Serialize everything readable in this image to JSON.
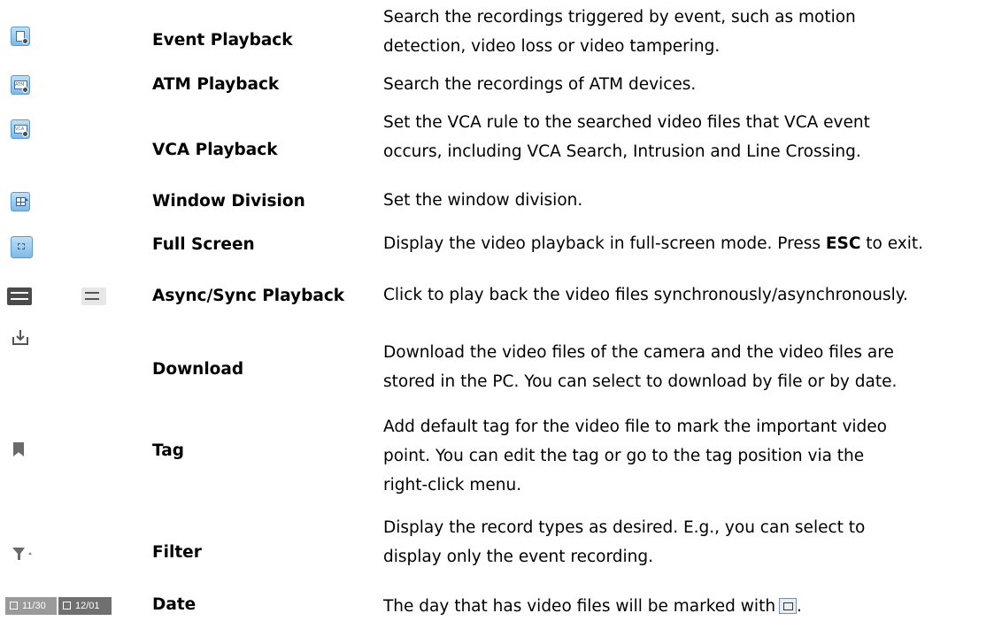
{
  "rows": [
    {
      "name": "Event Playback",
      "desc": [
        "Search the recordings triggered by event, such as motion",
        "detection, video loss or video tampering."
      ],
      "icon": "event-playback-icon"
    },
    {
      "name": "ATM Playback",
      "desc": [
        "Search the recordings of ATM devices."
      ],
      "icon": "atm-playback-icon",
      "icon_text": "ATM"
    },
    {
      "name": "VCA Playback",
      "desc": [
        "Set the VCA rule to the searched video files that VCA event",
        "occurs, including VCA Search, Intrusion and Line Crossing."
      ],
      "icon": "vca-playback-icon",
      "icon_text": "VCA"
    },
    {
      "name": "Window Division",
      "desc": [
        "Set the window division."
      ],
      "icon": "window-division-icon"
    },
    {
      "name": "Full Screen",
      "desc_pre": "Display the video playback in full-screen mode. Press ",
      "desc_bold": "ESC",
      "desc_post": " to exit.",
      "icon": "full-screen-icon"
    },
    {
      "name": "Async/Sync Playback",
      "desc": [
        "Click to play back the video files synchronously/asynchronously."
      ],
      "icon": "async-sync-icon"
    },
    {
      "name": "Download",
      "desc": [
        "Download the video files of the camera and the video files are",
        "stored in the PC. You can select to download by file or by date."
      ],
      "icon": "download-icon"
    },
    {
      "name": "Tag",
      "desc": [
        "Add default tag for the video file to mark the important video",
        "point. You can edit the tag or go to the tag position via the",
        "right-click menu."
      ],
      "icon": "tag-icon"
    },
    {
      "name": "Filter",
      "desc": [
        "Display the record types as desired. E.g., you can select to",
        "display only the event recording."
      ],
      "icon": "filter-icon"
    },
    {
      "name": "Date",
      "desc_pre": "The day that has video files will be marked with",
      "icon": "date-icon",
      "dates": [
        "11/30",
        "12/01"
      ]
    }
  ],
  "colors": {
    "icon_blue": "#7fb9e6",
    "sync_dark": "#4b4b4b",
    "date_grey": "#9a9a9a",
    "date_dark": "#707070"
  }
}
